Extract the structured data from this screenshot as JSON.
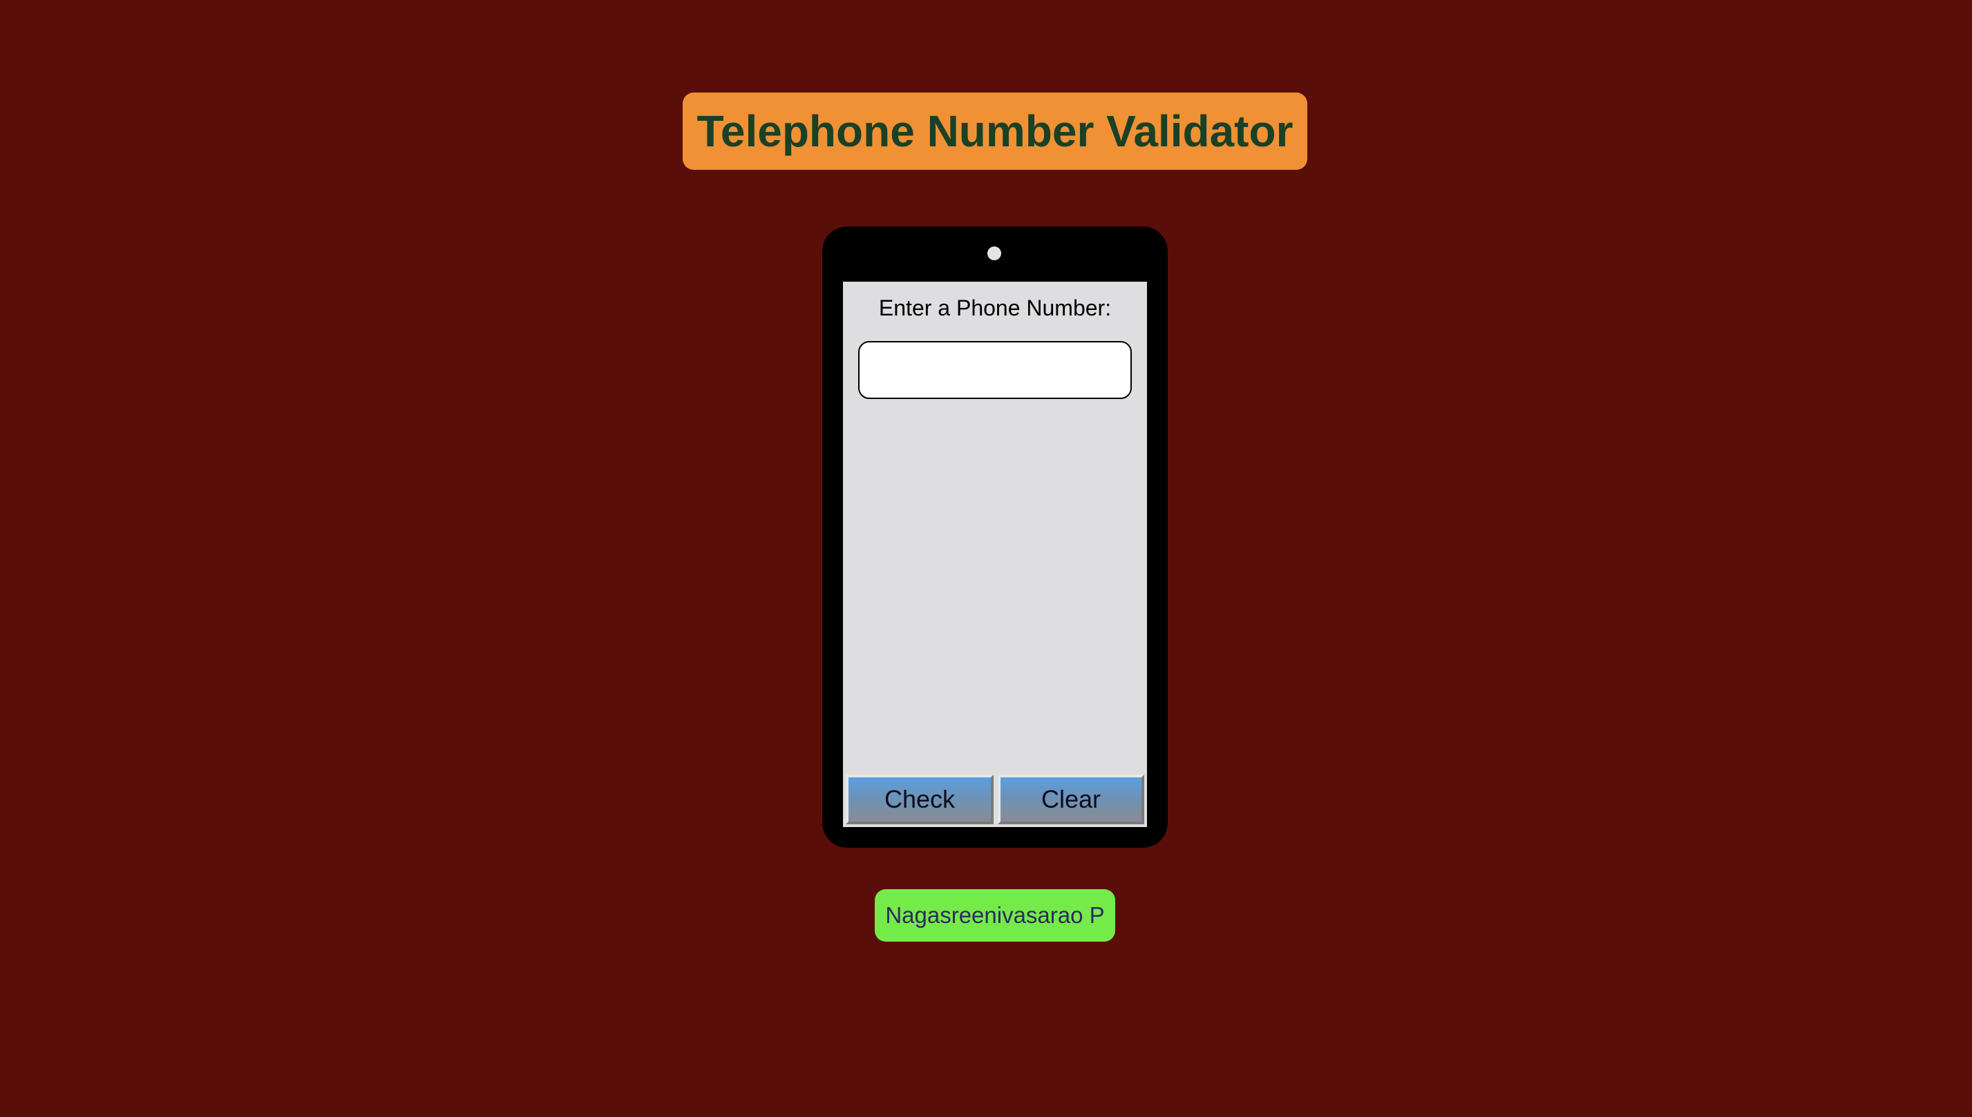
{
  "page": {
    "title": "Telephone Number Validator",
    "author": "Nagasreenivasarao P"
  },
  "phone": {
    "prompt": "Enter a Phone Number:",
    "input": {
      "value": "",
      "placeholder": ""
    },
    "buttons": {
      "check_label": "Check",
      "clear_label": "Clear"
    }
  },
  "colors": {
    "background": "#5a0e0a",
    "title_bg": "#f09135",
    "title_text": "#1a4025",
    "phone_body": "#000000",
    "screen": "#dedee0",
    "button_top": "#5c9ee0",
    "button_bottom": "#888c94",
    "author_bg": "#75eb4a",
    "author_text": "#2c2a5c"
  },
  "icons": {
    "camera": "camera-dot-icon"
  }
}
